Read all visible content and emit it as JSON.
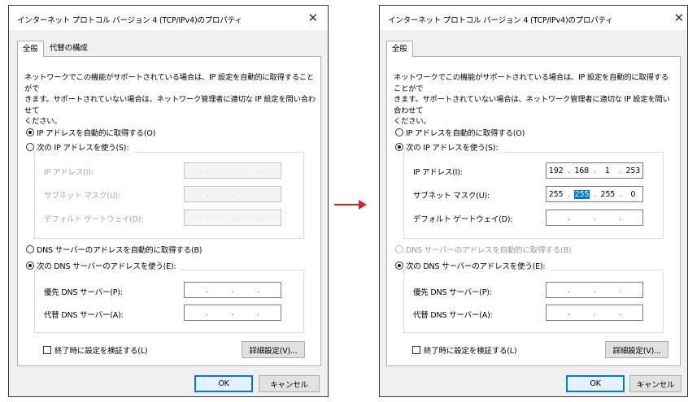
{
  "arrow_color": "#e02020",
  "dialogs": [
    {
      "title": "インターネット プロトコル バージョン 4 (TCP/IPv4)のプロパティ",
      "close_glyph": "✕",
      "tabs": [
        "全般",
        "代替の構成"
      ],
      "description": "ネットワークでこの機能がサポートされている場合は、IP 設定を自動的に取得することがで\nきます。サポートされていない場合は、ネットワーク管理者に適切な IP 設定を問い合わせて\nください。",
      "ip_auto_label": "IP アドレスを自動的に取得する(O)",
      "ip_manual_label": "次の IP アドレスを使う(S):",
      "ip_mode": "auto",
      "ip_address_label": "IP アドレス(I):",
      "subnet_label": "サブネット マスク(U):",
      "gateway_label": "デフォルト ゲートウェイ(D):",
      "dns_auto_label": "DNS サーバーのアドレスを自動的に取得する(B)",
      "dns_manual_label": "次の DNS サーバーのアドレスを使う(E):",
      "dns_mode": "manual",
      "preferred_dns_label": "優先 DNS サーバー(P):",
      "alternate_dns_label": "代替 DNS サーバー(A):",
      "validate_label": "終了時に設定を検証する(L)",
      "advanced_button": "詳細設定(V)...",
      "ok_button": "OK",
      "cancel_button": "キャンセル",
      "ip_address": [
        "",
        "",
        "",
        ""
      ],
      "subnet_mask": [
        "",
        "",
        "",
        ""
      ],
      "gateway": [
        "",
        "",
        "",
        ""
      ]
    },
    {
      "title": "インターネット プロトコル バージョン 4 (TCP/IPv4)のプロパティ",
      "close_glyph": "✕",
      "tabs": [
        "全般"
      ],
      "description": "ネットワークでこの機能がサポートされている場合は、IP 設定を自動的に取得することがで\nきます。サポートされていない場合は、ネットワーク管理者に適切な IP 設定を問い合わせて\nください。",
      "ip_auto_label": "IP アドレスを自動的に取得する(O)",
      "ip_manual_label": "次の IP アドレスを使う(S):",
      "ip_mode": "manual",
      "ip_address_label": "IP アドレス(I):",
      "subnet_label": "サブネット マスク(U):",
      "gateway_label": "デフォルト ゲートウェイ(D):",
      "dns_auto_label": "DNS サーバーのアドレスを自動的に取得する(B)",
      "dns_manual_label": "次の DNS サーバーのアドレスを使う(E):",
      "dns_mode": "manual",
      "preferred_dns_label": "優先 DNS サーバー(P):",
      "alternate_dns_label": "代替 DNS サーバー(A):",
      "validate_label": "終了時に設定を検証する(L)",
      "advanced_button": "詳細設定(V)...",
      "ok_button": "OK",
      "cancel_button": "キャンセル",
      "ip_address": [
        "192",
        "168",
        "1",
        "253"
      ],
      "subnet_mask": [
        "255",
        "255",
        "255",
        "0"
      ],
      "subnet_selected_octet": "255",
      "gateway": [
        "",
        "",
        "",
        ""
      ]
    }
  ]
}
